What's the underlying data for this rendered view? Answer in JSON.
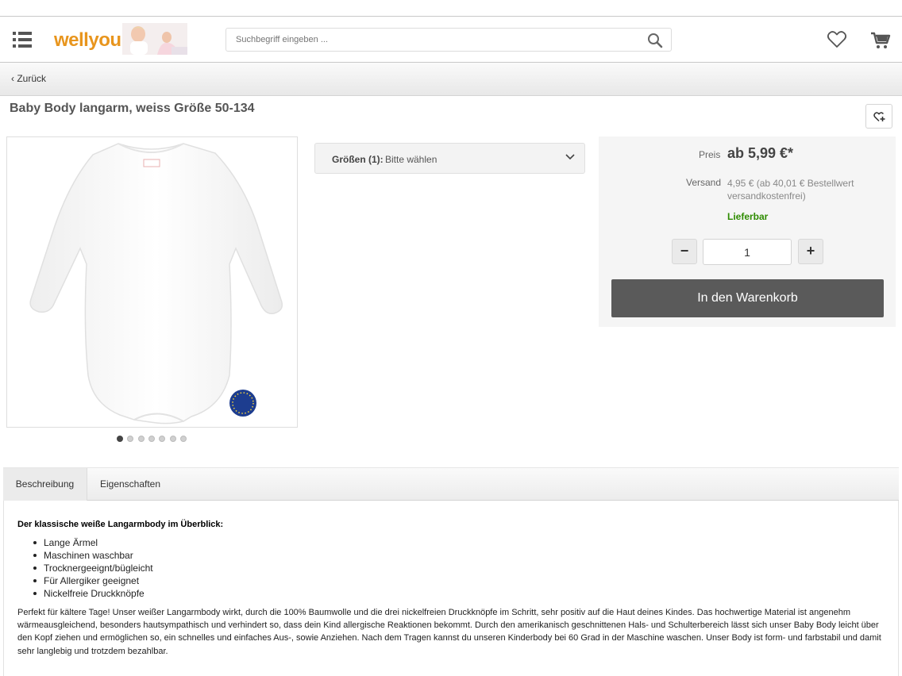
{
  "header": {
    "logo_text": "wellyou",
    "search_placeholder": "Suchbegriff eingeben ..."
  },
  "breadcrumb": {
    "back_label": "Zurück"
  },
  "product": {
    "title": "Baby Body langarm, weiss Größe 50-134",
    "image_badge_text": "Made in EUROPE",
    "gallery_count": 7,
    "gallery_active_index": 0
  },
  "variant": {
    "label": "Größen (1):",
    "value": "Bitte wählen"
  },
  "buybox": {
    "price_label": "Preis",
    "price_value": "ab 5,99 €*",
    "shipping_label": "Versand",
    "shipping_value": "4,95 € (ab 40,01 € Bestellwert versandkostenfrei)",
    "availability": "Lieferbar",
    "minus_label": "−",
    "plus_label": "+",
    "quantity": "1",
    "cart_button": "In den Warenkorb"
  },
  "tabs": [
    {
      "label": "Beschreibung",
      "active": true
    },
    {
      "label": "Eigenschaften",
      "active": false
    }
  ],
  "description": {
    "heading": "Der klassische weiße Langarmbody im Überblick:",
    "features": [
      "Lange Ärmel",
      "Maschinen waschbar",
      "Trocknergeeignt/bügleicht",
      "Für Allergiker geeignet",
      "Nickelfreie Druckknöpfe"
    ],
    "text": "Perfekt für kältere Tage! Unser weißer Langarmbody wirkt, durch die 100% Baumwolle und die drei nickelfreien Druckknöpfe im Schritt, sehr positiv auf die Haut deines Kindes. Das hochwertige Material ist angenehm wärmeausgleichend, besonders hautsympathisch und verhindert so, dass dein Kind allergische Reaktionen bekommt. Durch den amerikanisch geschnittenen Hals- und Schulterbereich lässt sich unser Baby Body leicht über den Kopf ziehen und ermöglichen so, ein schnelles und einfaches Aus-, sowie Anziehen. Nach dem Tragen kannst du unseren Kinderbody bei 60 Grad in der Maschine waschen. Unser Body ist form- und farbstabil und damit sehr langlebig und trotzdem bezahlbar."
  },
  "colors": {
    "accent": "#e8951d",
    "availability": "#2e8b00",
    "cart_button": "#5a5a5a"
  }
}
